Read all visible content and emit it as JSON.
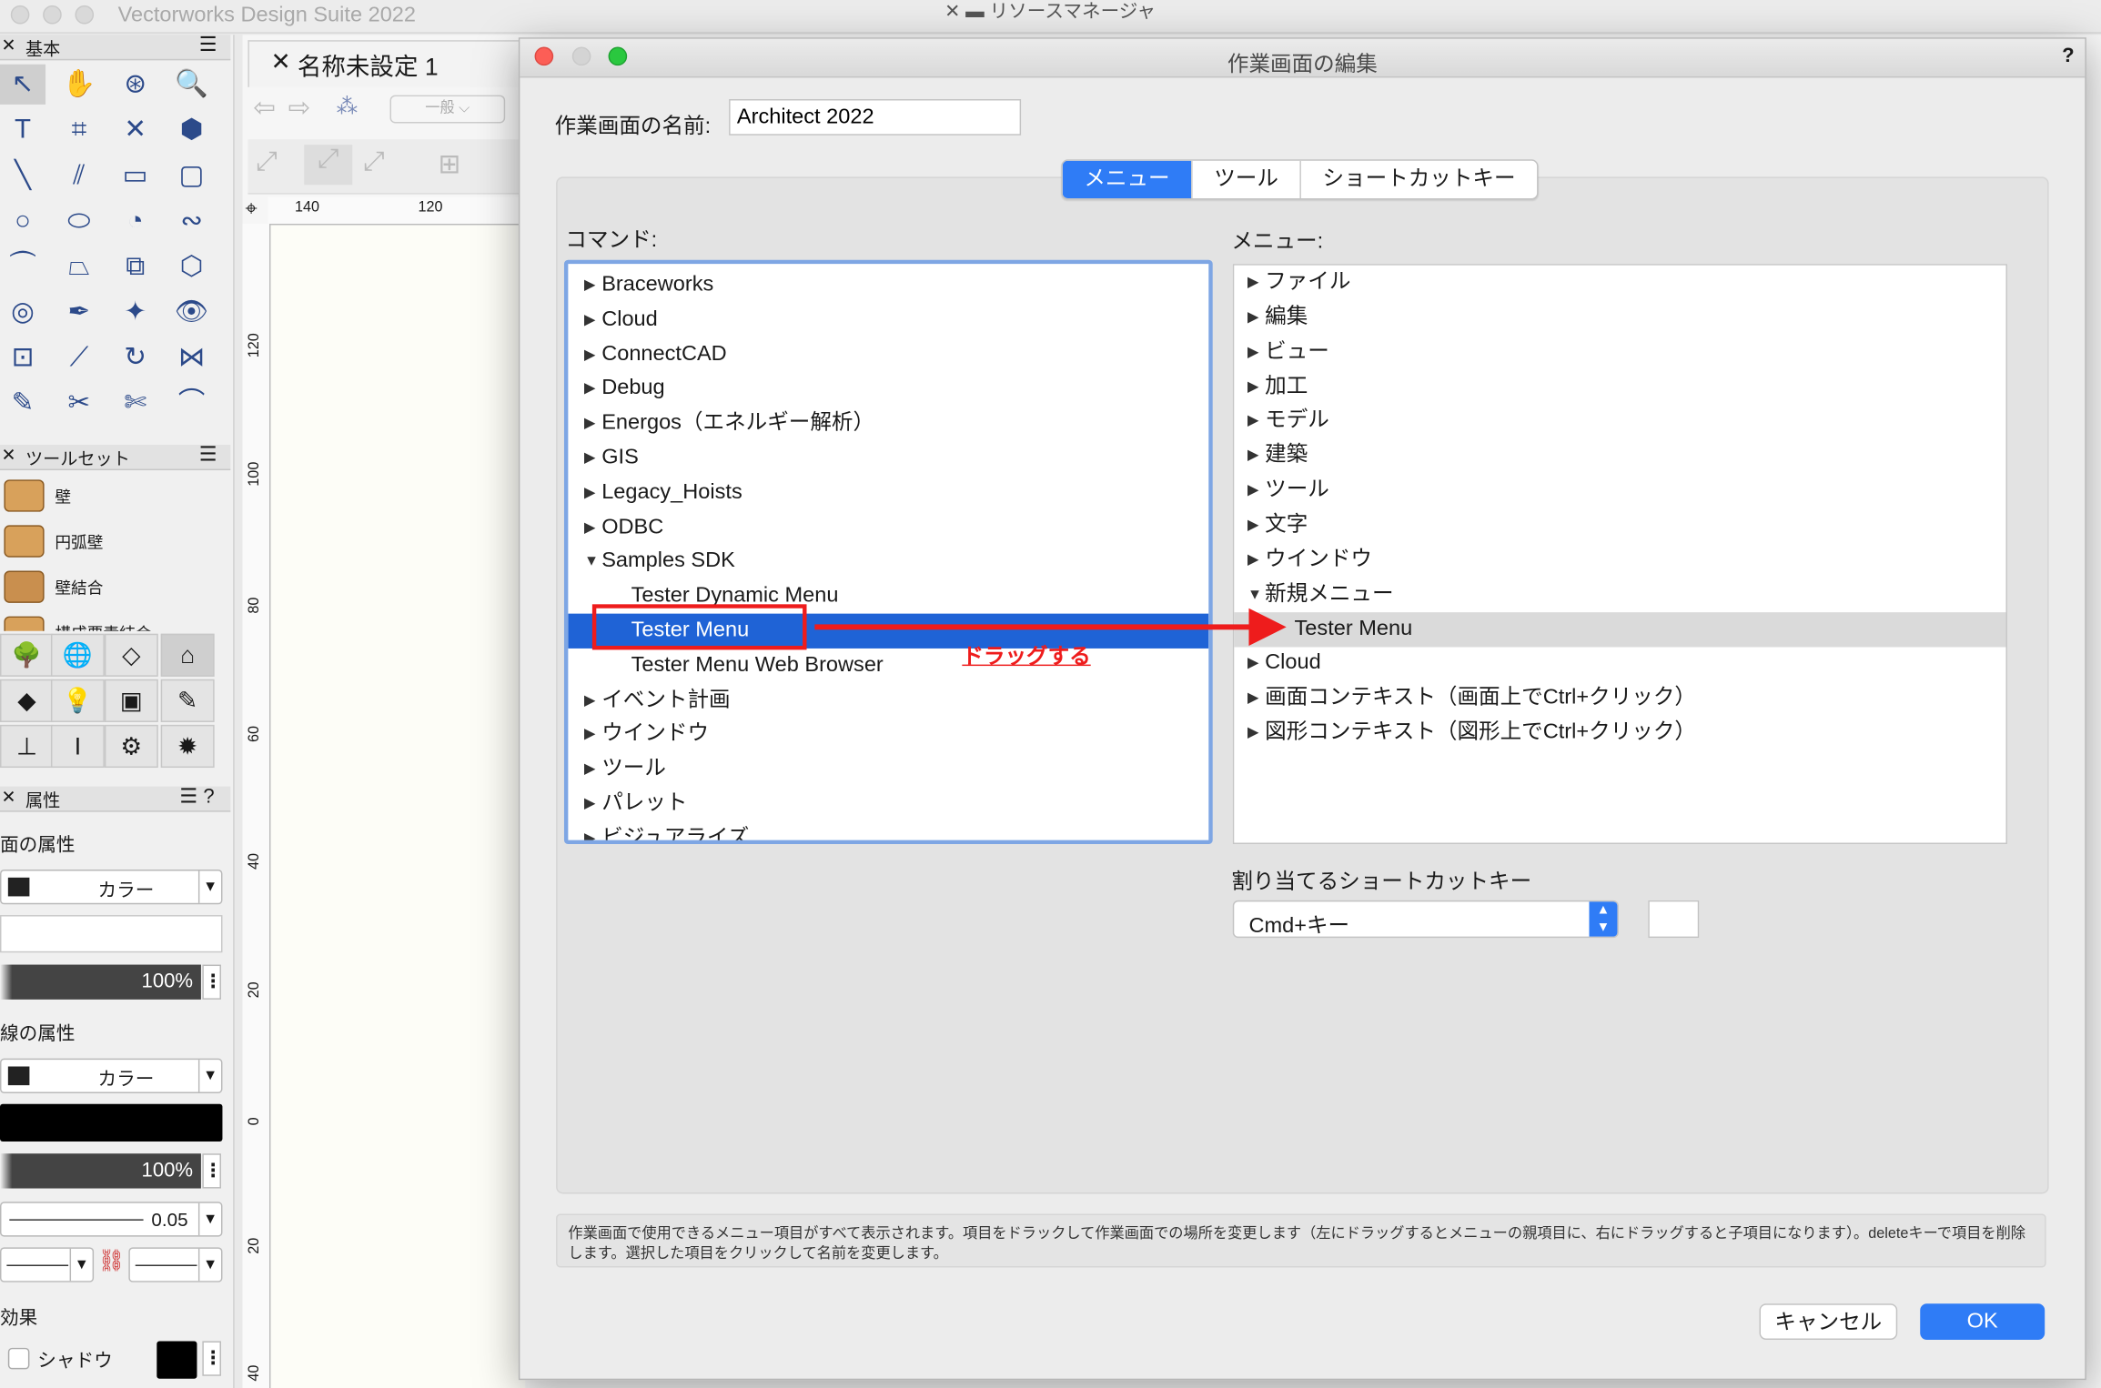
{
  "app": {
    "title": "Vectorworks Design Suite 2022",
    "resource_manager": "リソースマネージャ"
  },
  "palette": {
    "basic": {
      "title": "基本"
    },
    "toolsets": {
      "title": "ツールセット",
      "items": [
        {
          "label": "壁"
        },
        {
          "label": "円弧壁"
        },
        {
          "label": "壁結合"
        },
        {
          "label": "構成要素結合"
        }
      ]
    },
    "attributes": {
      "title": "属性",
      "fill_title": "面の属性",
      "fill_mode": "カラー",
      "fill_opacity": "100%",
      "line_title": "線の属性",
      "line_mode": "カラー",
      "line_opacity": "100%",
      "line_weight": "0.05",
      "effects_title": "効果",
      "shadow_label": "シャドウ"
    }
  },
  "document": {
    "tab_title": "名称未設定 1",
    "class_dropdown": "一般",
    "ruler_h": [
      "140",
      "120"
    ],
    "ruler_v": [
      "120",
      "100",
      "80",
      "60",
      "40",
      "20",
      "0",
      "20",
      "40"
    ]
  },
  "dialog": {
    "title": "作業画面の編集",
    "help": "?",
    "name_label": "作業画面の名前:",
    "name_value": "Architect 2022",
    "tabs": [
      {
        "label": "メニュー",
        "active": true
      },
      {
        "label": "ツール"
      },
      {
        "label": "ショートカットキー"
      }
    ],
    "commands_label": "コマンド:",
    "commands": [
      {
        "label": "Braceworks",
        "tri": "▶"
      },
      {
        "label": "Cloud",
        "tri": "▶"
      },
      {
        "label": "ConnectCAD",
        "tri": "▶"
      },
      {
        "label": "Debug",
        "tri": "▶"
      },
      {
        "label": "Energos（エネルギー解析）",
        "tri": "▶"
      },
      {
        "label": "GIS",
        "tri": "▶"
      },
      {
        "label": "Legacy_Hoists",
        "tri": "▶"
      },
      {
        "label": "ODBC",
        "tri": "▶"
      },
      {
        "label": "Samples SDK",
        "tri": "▼"
      },
      {
        "label": "Tester Dynamic Menu",
        "tri": ""
      },
      {
        "label": "Tester Menu",
        "tri": "",
        "selected": true
      },
      {
        "label": "Tester Menu Web Browser",
        "tri": ""
      },
      {
        "label": "イベント計画",
        "tri": "▶"
      },
      {
        "label": "ウインドウ",
        "tri": "▶"
      },
      {
        "label": "ツール",
        "tri": "▶"
      },
      {
        "label": "パレット",
        "tri": "▶"
      },
      {
        "label": "ビジュアライズ",
        "tri": "▶"
      }
    ],
    "menus_label": "メニュー:",
    "menus": [
      {
        "label": "ファイル",
        "tri": "▶"
      },
      {
        "label": "編集",
        "tri": "▶"
      },
      {
        "label": "ビュー",
        "tri": "▶"
      },
      {
        "label": "加工",
        "tri": "▶"
      },
      {
        "label": "モデル",
        "tri": "▶"
      },
      {
        "label": "建築",
        "tri": "▶"
      },
      {
        "label": "ツール",
        "tri": "▶"
      },
      {
        "label": "文字",
        "tri": "▶"
      },
      {
        "label": "ウインドウ",
        "tri": "▶"
      },
      {
        "label": "新規メニュー",
        "tri": "▼"
      },
      {
        "label": "Tester Menu",
        "tri": "",
        "highlighted": true
      },
      {
        "label": "Cloud",
        "tri": "▶"
      },
      {
        "label": "画面コンテキスト（画面上でCtrl+クリック）",
        "tri": "▶"
      },
      {
        "label": "図形コンテキスト（図形上でCtrl+クリック）",
        "tri": "▶"
      }
    ],
    "drag_annotation": "ドラッグする",
    "shortcut_label": "割り当てるショートカットキー",
    "shortcut_modifier": "Cmd+キー",
    "help_text": "作業画面で使用できるメニュー項目がすべて表示されます。項目をドラックして作業画面での場所を変更します（左にドラッグするとメニューの親項目に、右にドラッグすると子項目になります）。deleteキーで項目を削除します。選択した項目をクリックして名前を変更します。",
    "cancel": "キャンセル",
    "ok": "OK"
  },
  "colors": {
    "accent": "#2f7cf6",
    "selection": "#1f63d6",
    "annotation": "#ee1c1c"
  }
}
